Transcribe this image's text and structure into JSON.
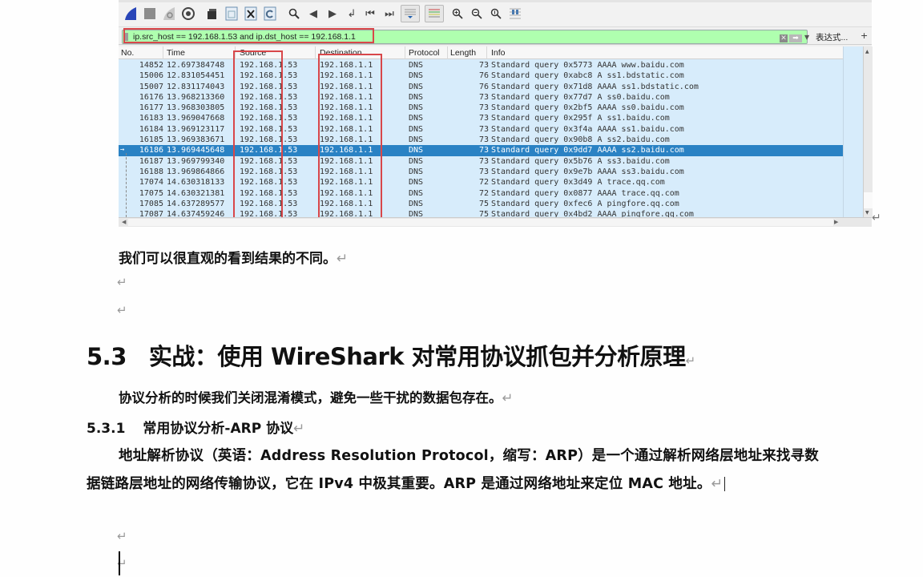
{
  "wireshark": {
    "toolbar_icons": [
      "shark-fin-start-icon",
      "stop-capture-icon",
      "restart-capture-icon",
      "capture-options-icon",
      "open-file-icon",
      "save-file-icon",
      "close-file-icon",
      "reload-file-icon",
      "find-packet-icon",
      "go-back-icon",
      "go-forward-icon",
      "go-to-packet-icon",
      "first-packet-icon",
      "last-packet-icon",
      "autoscroll-icon",
      "colorize-icon",
      "zoom-in-icon",
      "zoom-out-icon",
      "normal-size-icon",
      "resize-columns-icon"
    ],
    "filter": {
      "value": "ip.src_host == 192.168.1.53 and ip.dst_host == 192.168.1.1",
      "expression_label": "表达式...",
      "plus_label": "+",
      "bg_color": "#afffaf"
    },
    "columns": [
      "No.",
      "Time",
      "Source",
      "Destination",
      "Protocol",
      "Length",
      "Info"
    ],
    "selected_no": "16186",
    "packets": [
      {
        "no": "14852",
        "time": "12.697384748",
        "src": "192.168.1.53",
        "dst": "192.168.1.1",
        "proto": "DNS",
        "len": "73",
        "info": "Standard query 0x5773 AAAA www.baidu.com"
      },
      {
        "no": "15006",
        "time": "12.831054451",
        "src": "192.168.1.53",
        "dst": "192.168.1.1",
        "proto": "DNS",
        "len": "76",
        "info": "Standard query 0xabc8 A ss1.bdstatic.com"
      },
      {
        "no": "15007",
        "time": "12.831174043",
        "src": "192.168.1.53",
        "dst": "192.168.1.1",
        "proto": "DNS",
        "len": "76",
        "info": "Standard query 0x71d8 AAAA ss1.bdstatic.com"
      },
      {
        "no": "16176",
        "time": "13.968213360",
        "src": "192.168.1.53",
        "dst": "192.168.1.1",
        "proto": "DNS",
        "len": "73",
        "info": "Standard query 0x77d7 A ss0.baidu.com"
      },
      {
        "no": "16177",
        "time": "13.968303805",
        "src": "192.168.1.53",
        "dst": "192.168.1.1",
        "proto": "DNS",
        "len": "73",
        "info": "Standard query 0x2bf5 AAAA ss0.baidu.com"
      },
      {
        "no": "16183",
        "time": "13.969047668",
        "src": "192.168.1.53",
        "dst": "192.168.1.1",
        "proto": "DNS",
        "len": "73",
        "info": "Standard query 0x295f A ss1.baidu.com"
      },
      {
        "no": "16184",
        "time": "13.969123117",
        "src": "192.168.1.53",
        "dst": "192.168.1.1",
        "proto": "DNS",
        "len": "73",
        "info": "Standard query 0x3f4a AAAA ss1.baidu.com"
      },
      {
        "no": "16185",
        "time": "13.969383671",
        "src": "192.168.1.53",
        "dst": "192.168.1.1",
        "proto": "DNS",
        "len": "73",
        "info": "Standard query 0x90b8 A ss2.baidu.com"
      },
      {
        "no": "16186",
        "time": "13.969445648",
        "src": "192.168.1.53",
        "dst": "192.168.1.1",
        "proto": "DNS",
        "len": "73",
        "info": "Standard query 0x9dd7 AAAA ss2.baidu.com"
      },
      {
        "no": "16187",
        "time": "13.969799340",
        "src": "192.168.1.53",
        "dst": "192.168.1.1",
        "proto": "DNS",
        "len": "73",
        "info": "Standard query 0x5b76 A ss3.baidu.com"
      },
      {
        "no": "16188",
        "time": "13.969864866",
        "src": "192.168.1.53",
        "dst": "192.168.1.1",
        "proto": "DNS",
        "len": "73",
        "info": "Standard query 0x9e7b AAAA ss3.baidu.com"
      },
      {
        "no": "17074",
        "time": "14.630318133",
        "src": "192.168.1.53",
        "dst": "192.168.1.1",
        "proto": "DNS",
        "len": "72",
        "info": "Standard query 0x3d49 A trace.qq.com"
      },
      {
        "no": "17075",
        "time": "14.630321381",
        "src": "192.168.1.53",
        "dst": "192.168.1.1",
        "proto": "DNS",
        "len": "72",
        "info": "Standard query 0x0877 AAAA trace.qq.com"
      },
      {
        "no": "17085",
        "time": "14.637289577",
        "src": "192.168.1.53",
        "dst": "192.168.1.1",
        "proto": "DNS",
        "len": "75",
        "info": "Standard query 0xfec6 A pingfore.qq.com"
      },
      {
        "no": "17087",
        "time": "14.637459246",
        "src": "192.168.1.53",
        "dst": "192.168.1.1",
        "proto": "DNS",
        "len": "75",
        "info": "Standard query 0x4bd2 AAAA pingfore.qq.com"
      }
    ],
    "colors": {
      "row_bg": "#d7ecfb",
      "selected_bg": "#2a82c4",
      "highlight_box": "#d8474a"
    }
  },
  "document": {
    "paragraph_mark": "↵",
    "p1": "我们可以很直观的看到结果的不同。",
    "heading_5_3": {
      "number": "5.3",
      "title": "实战：使用 WireShark 对常用协议抓包并分析原理"
    },
    "p2": "协议分析的时候我们关闭混淆模式，避免一些干扰的数据包存在。",
    "heading_5_3_1": {
      "number": "5.3.1",
      "title": "常用协议分析-ARP 协议"
    },
    "p3": "地址解析协议（英语：Address Resolution Protocol，缩写：ARP）是一个通过解析网络层地址来找寻数据链路层地址的网络传输协议，它在 IPv4 中极其重要。ARP 是通过网络地址来定位 MAC 地址。"
  }
}
